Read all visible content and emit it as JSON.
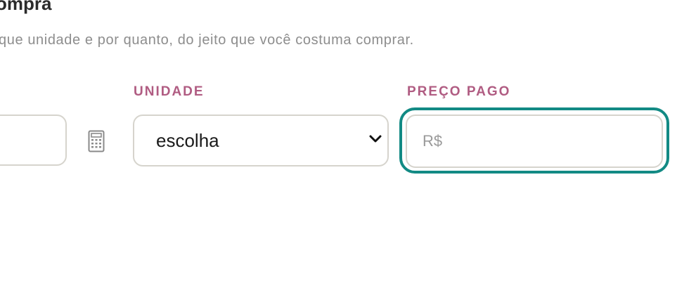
{
  "header": {
    "title": "ompra",
    "subtitle": "que unidade e por quanto, do jeito que você costuma comprar."
  },
  "form": {
    "unit_label": "UNIDADE",
    "price_label": "PREÇO PAGO",
    "unit_select_value": "escolha",
    "price_placeholder": "R$"
  },
  "icons": {
    "calculator": "calculator-icon",
    "dropdown": "chevron-down-icon"
  },
  "colors": {
    "label": "#b05c82",
    "focus_ring": "#128a84",
    "input_border": "#d6d4cd",
    "subtitle": "#8d8d8d"
  }
}
